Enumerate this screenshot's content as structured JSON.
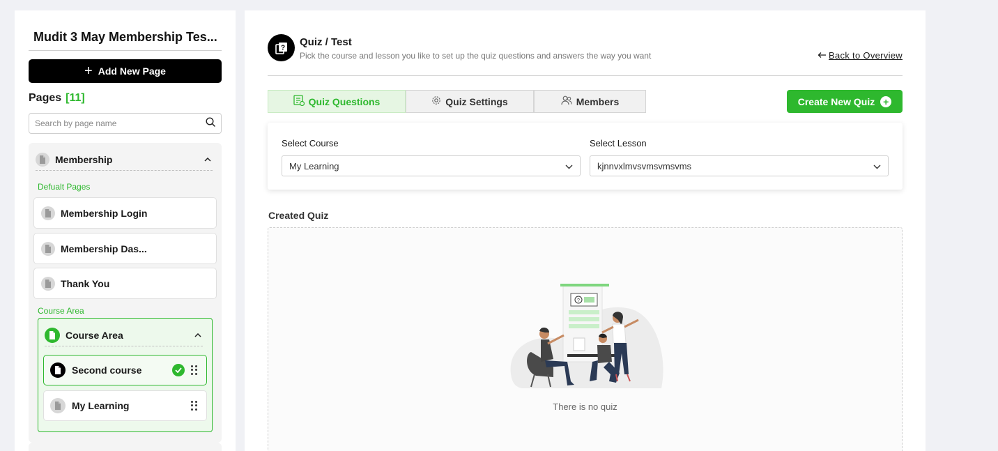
{
  "sidebar": {
    "site_title": "Mudit 3 May Membership Tes...",
    "add_page_label": "Add New Page",
    "pages_heading": "Pages",
    "pages_count": "[11]",
    "search_placeholder": "Search by page name",
    "group": {
      "title": "Membership",
      "default_section_label": "Defualt Pages",
      "default_pages": [
        "Membership Login",
        "Membership Das...",
        "Thank You"
      ],
      "course_section_label": "Course Area",
      "course_area": {
        "title": "Course Area",
        "lessons": [
          "Second course",
          "My Learning"
        ]
      }
    }
  },
  "main": {
    "title": "Quiz / Test",
    "subtitle": "Pick the course and lesson you like to set up the quiz questions and answers the way you want",
    "back_label": "Back to Overview",
    "tabs": [
      "Quiz Questions",
      "Quiz Settings",
      "Members"
    ],
    "create_label": "Create New Quiz",
    "select_course_label": "Select Course",
    "select_course_value": "My Learning",
    "select_lesson_label": "Select Lesson",
    "select_lesson_value": "kjnnvxlmvsvmsvmsvms",
    "created_quiz_label": "Created Quiz",
    "empty_text": "There is no quiz"
  },
  "colors": {
    "accent": "#2eb82e",
    "background": "#f0f1f5",
    "button_dark": "#000000"
  }
}
